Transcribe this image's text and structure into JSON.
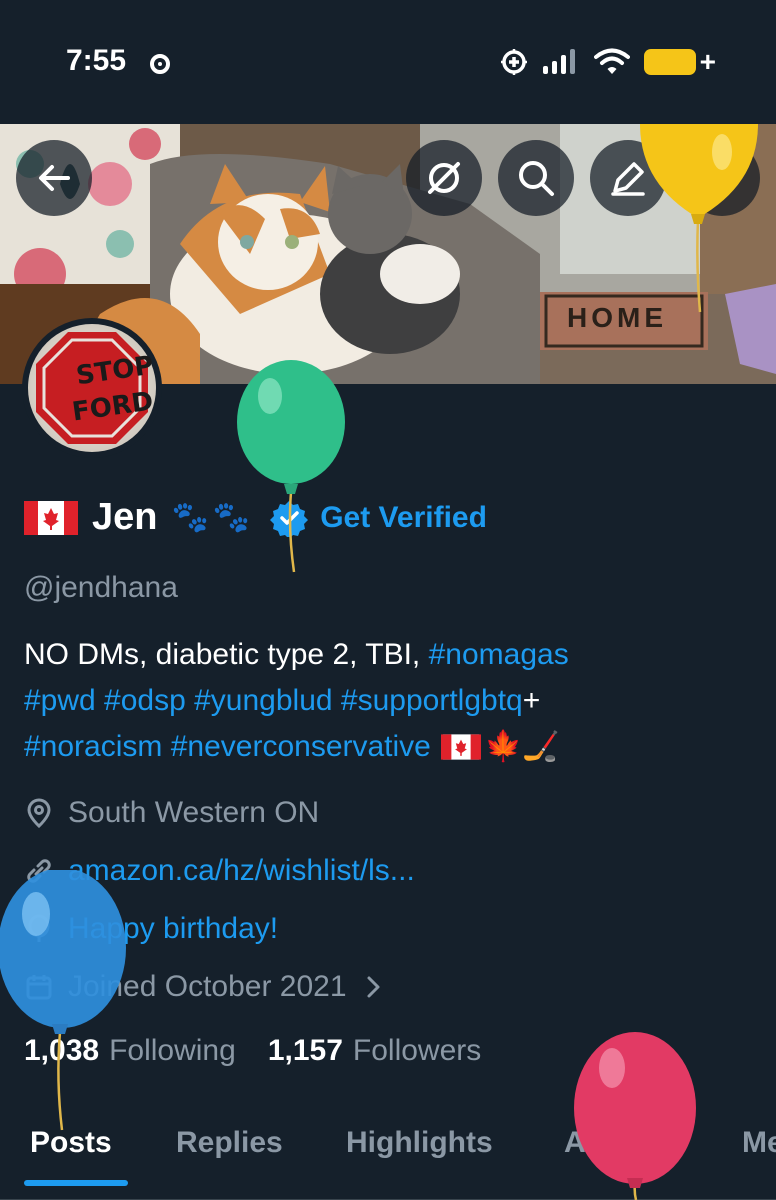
{
  "status_bar": {
    "time": "7:55"
  },
  "header": {
    "buttons": [
      "back",
      "grok",
      "search",
      "edit",
      "more"
    ],
    "banner_sign": "HOME"
  },
  "avatar": {
    "sign_line1": "STOP",
    "sign_line2": "FORD"
  },
  "profile": {
    "display_name": "Jen",
    "paws": "🐾🐾",
    "get_verified": "Get Verified",
    "handle": "@jendhana",
    "bio": {
      "line1_text": "NO DMs, diabetic type 2, TBI, ",
      "line1_tag": "#nomagas",
      "line2_tags": "#pwd #odsp #yungblud  #supportlgbtq",
      "line2_tail": "+",
      "line3_tags": "#noracism #neverconservative",
      "line3_emoji": "🍁🏒"
    },
    "location": "South Western ON",
    "website": "amazon.ca/hz/wishlist/ls...",
    "birthday": "Happy birthday!",
    "joined": "Joined October 2021",
    "following_count": "1,038",
    "following_label": "Following",
    "followers_count": "1,157",
    "followers_label": "Followers"
  },
  "tabs": [
    {
      "label": "Posts",
      "active": true
    },
    {
      "label": "Replies",
      "active": false
    },
    {
      "label": "Highlights",
      "active": false
    },
    {
      "label": "Articles",
      "active": false
    },
    {
      "label": "Me",
      "active": false
    }
  ],
  "colors": {
    "background": "#15202b",
    "accent": "#1d9bf0",
    "secondary_text": "#8b98a5"
  },
  "balloons": [
    "green",
    "yellow",
    "blue",
    "red"
  ]
}
